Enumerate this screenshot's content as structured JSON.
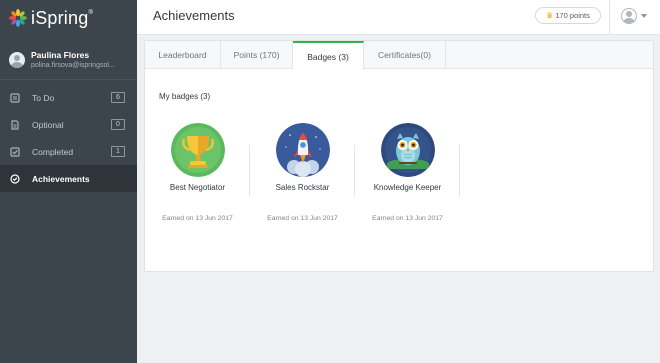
{
  "app": {
    "logo_text": "iSpring"
  },
  "user": {
    "name": "Paulina Flores",
    "email": "polina.firsova@ispringsol..."
  },
  "nav": [
    {
      "label": "To Do",
      "count": "6",
      "icon": "todo-icon"
    },
    {
      "label": "Optional",
      "count": "0",
      "icon": "document-icon"
    },
    {
      "label": "Completed",
      "count": "1",
      "icon": "checkbox-icon"
    },
    {
      "label": "Achievements",
      "count": "",
      "icon": "badge-icon"
    }
  ],
  "header": {
    "title": "Achievements",
    "points": "170 points"
  },
  "tabs": [
    {
      "label": "Leaderboard"
    },
    {
      "label": "Points (170)"
    },
    {
      "label": "Badges (3)"
    },
    {
      "label": "Certificates(0)"
    }
  ],
  "badges_section": {
    "title": "My badges (3)"
  },
  "badges": [
    {
      "name": "Best Negotiator",
      "date": "Earned on 13 Jun 2017",
      "icon": "trophy-icon"
    },
    {
      "name": "Sales Rockstar",
      "date": "Earned on 13 Jun 2017",
      "icon": "rocket-icon"
    },
    {
      "name": "Knowledge Keeper",
      "date": "Earned on 13 Jun 2017",
      "icon": "owl-icon"
    }
  ],
  "colors": {
    "sidebar": "#3d454c",
    "accent": "#33b24a",
    "points_crown": "#f0a500"
  }
}
